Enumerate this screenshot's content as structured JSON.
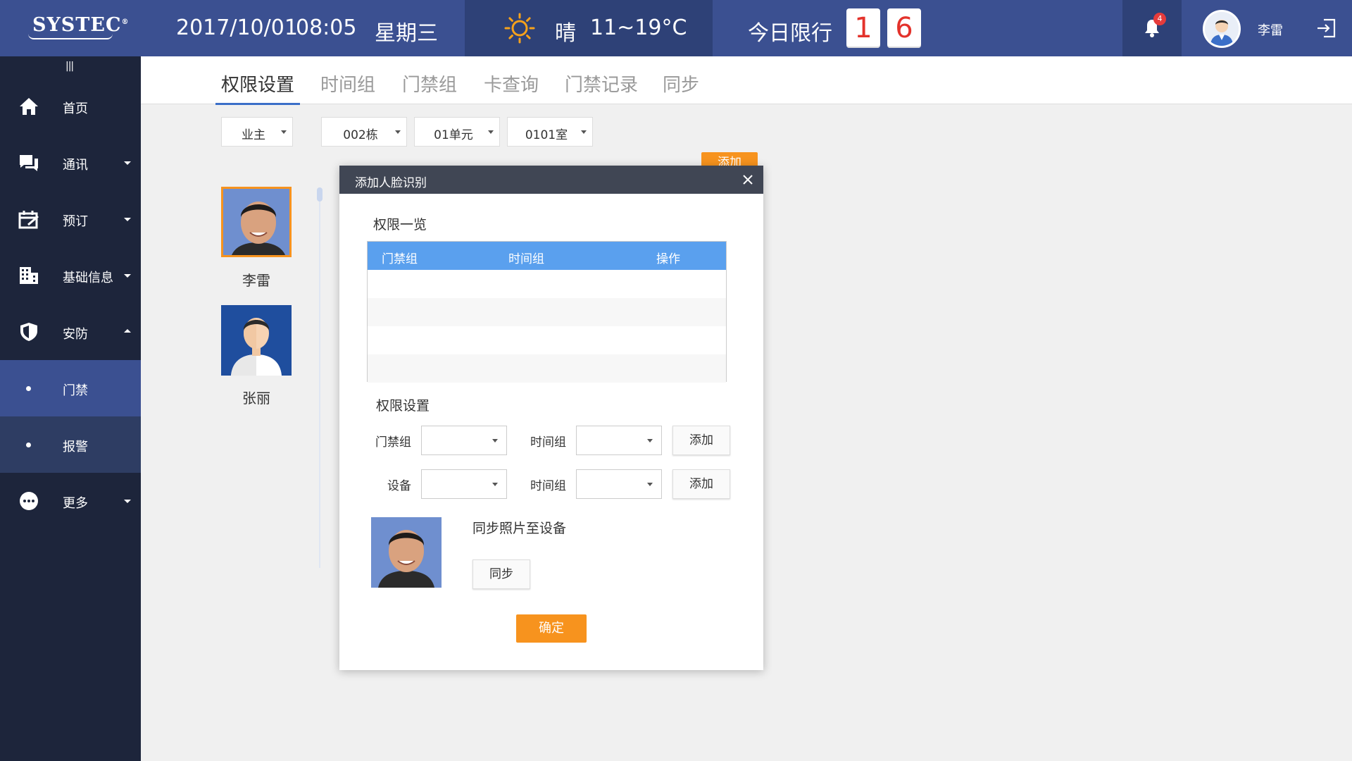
{
  "header": {
    "logo": "SYSTEC",
    "logo_mark": "®",
    "date": "2017/10/01",
    "time": "08:05",
    "weekday": "星期三",
    "weather_icon": "sun-icon",
    "weather": "晴",
    "temperature": "11~19°C",
    "limit_label": "今日限行",
    "limit_digits": [
      "1",
      "6"
    ],
    "notification_count": "4",
    "user_name": "李雷"
  },
  "sidebar": {
    "handle": "|||",
    "items": [
      {
        "label": "首页",
        "icon": "home-icon"
      },
      {
        "label": "通讯",
        "icon": "chat-icon"
      },
      {
        "label": "预订",
        "icon": "booking-icon"
      },
      {
        "label": "基础信息",
        "icon": "building-icon"
      },
      {
        "label": "安防",
        "icon": "shield-icon"
      },
      {
        "label": "门禁"
      },
      {
        "label": "报警"
      },
      {
        "label": "更多",
        "icon": "more-icon"
      }
    ]
  },
  "tabs": [
    "权限设置",
    "时间组",
    "门禁组",
    "卡查询",
    "门禁记录",
    "同步"
  ],
  "filters": {
    "role": "业主",
    "building": "002栋",
    "unit": "01单元",
    "room": "0101室"
  },
  "background_add_button": "添加",
  "people": [
    {
      "name": "李雷"
    },
    {
      "name": "张丽"
    }
  ],
  "modal": {
    "title": "添加人脸识别",
    "list_title": "权限一览",
    "table_headers": [
      "门禁组",
      "时间组",
      "操作"
    ],
    "settings_title": "权限设置",
    "row1": {
      "label_a": "门禁组",
      "label_b": "时间组",
      "button": "添加"
    },
    "row2": {
      "label_a": "设备",
      "label_b": "时间组",
      "button": "添加"
    },
    "sync_label": "同步照片至设备",
    "sync_button": "同步",
    "confirm_button": "确定"
  },
  "colors": {
    "header_bg": "#3b5091",
    "sidebar_bg": "#1d253b",
    "accent_orange": "#f7931e",
    "table_head_blue": "#5aa0ee"
  }
}
